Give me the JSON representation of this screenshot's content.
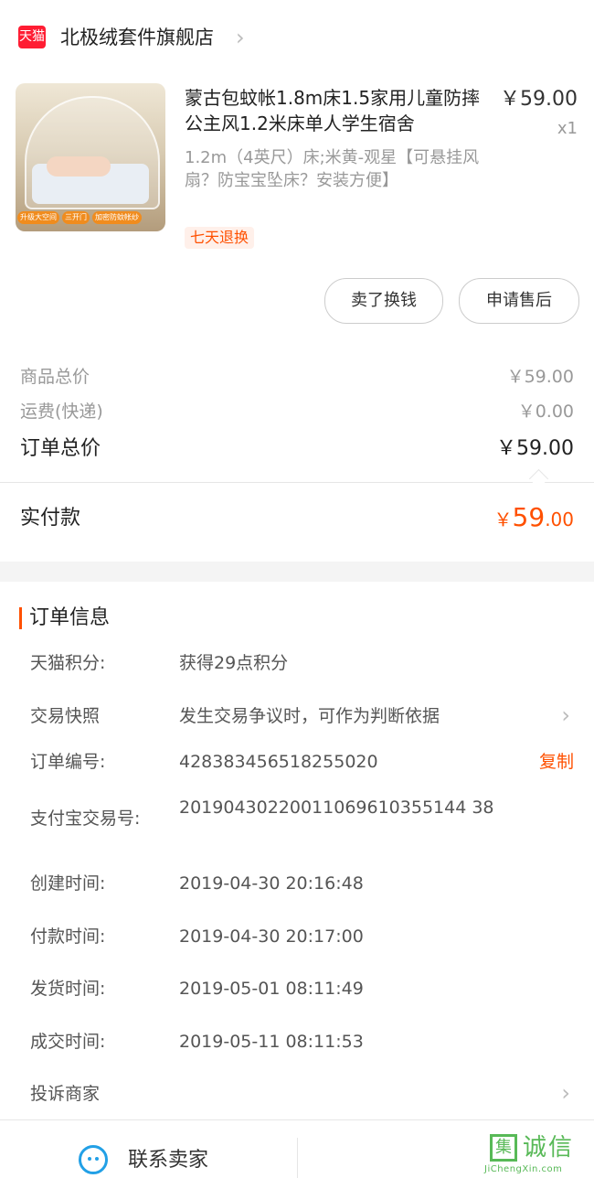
{
  "store": {
    "logo_text": "天猫",
    "name": "北极绒套件旗舰店",
    "chevron": "›"
  },
  "product": {
    "image_tags": [
      "升级大空间",
      "三开门",
      "加密防蚊帐纱"
    ],
    "title": "蒙古包蚊帐1.8m床1.5家用儿童防摔公主风1.2米床单人学生宿舍",
    "price": "￥59.00",
    "qty": "x1",
    "spec": "1.2m（4英尺）床;米黄-观星【可悬挂风扇？防宝宝坠床？安装方便】",
    "badge": "七天退换"
  },
  "actions": {
    "sell_label": "卖了换钱",
    "aftersale_label": "申请售后"
  },
  "summary": {
    "goods_total_label": "商品总价",
    "goods_total_value": "￥59.00",
    "shipping_label": "运费(快递)",
    "shipping_value": "￥0.00",
    "order_total_label": "订单总价",
    "order_total_value": "￥59.00",
    "paid_label": "实付款",
    "paid_symbol": "￥",
    "paid_int": "59",
    "paid_dec": ".00"
  },
  "order_info": {
    "title": "订单信息",
    "points_label": "天猫积分:",
    "points_value": "获得29点积分",
    "snapshot_label": "交易快照",
    "snapshot_value": "发生交易争议时，可作为判断依据",
    "order_no_label": "订单编号:",
    "order_no_value": "428383456518255020",
    "copy_label": "复制",
    "alipay_label": "支付宝交易号:",
    "alipay_value": "20190430220011069610355144 38",
    "created_label": "创建时间:",
    "created_value": "2019-04-30 20:16:48",
    "paid_time_label": "付款时间:",
    "paid_time_value": "2019-04-30 20:17:00",
    "shipped_label": "发货时间:",
    "shipped_value": "2019-05-01 08:11:49",
    "done_label": "成交时间:",
    "done_value": "2019-05-11 08:11:53",
    "complain_label": "投诉商家",
    "chevron": "›"
  },
  "footer": {
    "contact_label": "联系卖家"
  },
  "watermark": {
    "box": "集",
    "cn": "诚信",
    "en": "JiChengXin.com"
  },
  "colors": {
    "accent": "#ff5000",
    "tmall_red": "#ff1d33",
    "contact_blue": "#22a0e6"
  }
}
